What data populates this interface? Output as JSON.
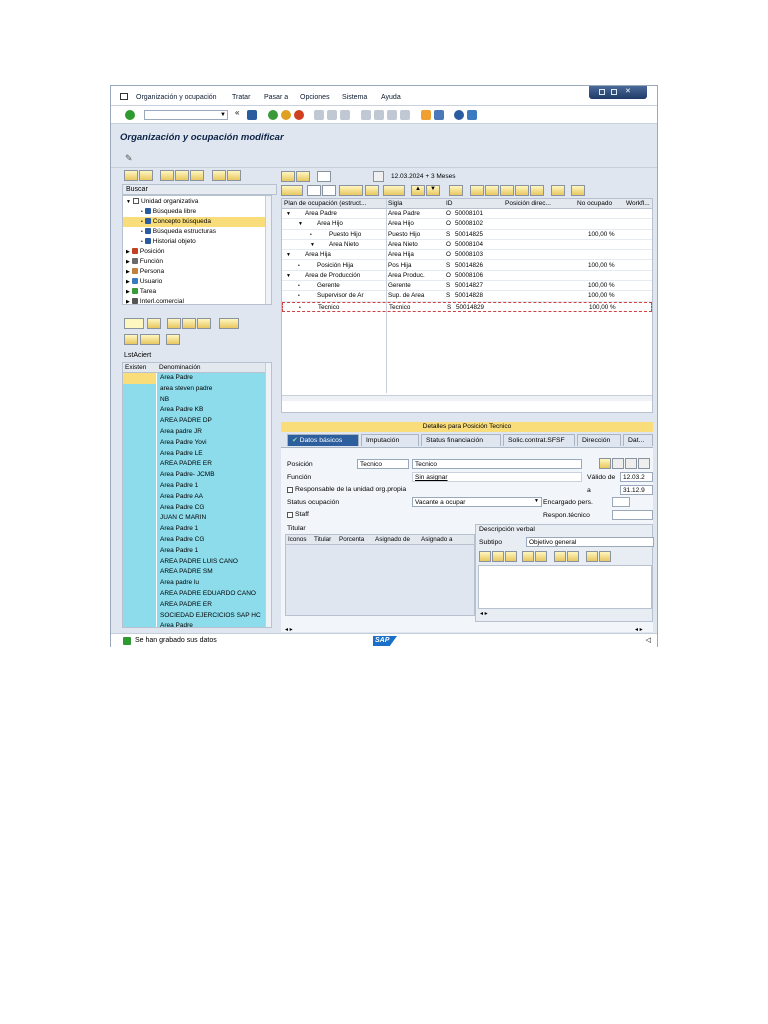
{
  "menu": {
    "items": [
      "Organización y ocupación",
      "Tratar",
      "Pasar a",
      "Opciones",
      "Sistema",
      "Ayuda"
    ]
  },
  "title": "Organización y ocupación modificar",
  "search": {
    "label": "Buscar"
  },
  "tree": [
    {
      "text": "Unidad organizativa",
      "level": 0,
      "icon": "square-icon",
      "expanded": true
    },
    {
      "text": "Búsqueda libre",
      "level": 1,
      "icon": "binoculars-icon"
    },
    {
      "text": "Concepto búsqueda",
      "level": 1,
      "icon": "binoculars-icon",
      "selected": true
    },
    {
      "text": "Búsqueda estructuras",
      "level": 1,
      "icon": "binoculars-icon"
    },
    {
      "text": "Historial objeto",
      "level": 1,
      "icon": "binoculars-icon"
    },
    {
      "text": "Posición",
      "level": 0,
      "icon": "person-icon"
    },
    {
      "text": "Función",
      "level": 0,
      "icon": "function-icon"
    },
    {
      "text": "Persona",
      "level": 0,
      "icon": "people-icon"
    },
    {
      "text": "Usuario",
      "level": 0,
      "icon": "user-icon"
    },
    {
      "text": "Tarea",
      "level": 0,
      "icon": "task-icon"
    },
    {
      "text": "Interl.comercial",
      "level": 0,
      "icon": "partner-icon"
    }
  ],
  "lst": {
    "label": "LstAciert",
    "headers": [
      "Existen",
      "Denominación"
    ],
    "rows": [
      "Area Padre",
      "area steven padre",
      "NB",
      "Area Padre KB",
      "AREA PADRE DP",
      "Area padre JR",
      "Area Padre Yovi",
      "Area Padre LE",
      "AREA PADRE ER",
      "Area Padre- JCMB",
      "Area Padre 1",
      "Area Padre AA",
      "Area Padre CG",
      "JUAN C MARIN",
      "Area Padre 1",
      "Area Padre CG",
      "Area Padre 1",
      "AREA PADRE LUIS CANO",
      "AREA PADRE SM",
      "Area padre lu",
      "AREA PADRE EDUARDO CANO",
      "AREA PADRE ER",
      "SOCIEDAD EJERCICIOS SAP HC",
      "Area Padre"
    ]
  },
  "date_range": "12.03.2024  + 3 Meses",
  "grid": {
    "headers": [
      "Plan de ocupación (estruct...",
      "Sigla",
      "ID",
      "Posición direc...",
      "No ocupado",
      "Workfl..."
    ],
    "rows": [
      {
        "name": "Area Padre",
        "level": 0,
        "icon": "square-icon",
        "sigla": "Area Padre",
        "type": "O",
        "id": "50008101",
        "pct": ""
      },
      {
        "name": "Area Hijo",
        "level": 1,
        "icon": "square-icon",
        "sigla": "Area Hijo",
        "type": "O",
        "id": "50008102",
        "pct": ""
      },
      {
        "name": "Puesto Hijo",
        "level": 2,
        "icon": "person-icon",
        "sigla": "Puesto Hijo",
        "type": "S",
        "id": "50014825",
        "pct": "100,00 %"
      },
      {
        "name": "Area Nieto",
        "level": 2,
        "icon": "square-icon",
        "sigla": "Area Nieto",
        "type": "O",
        "id": "50008104",
        "pct": ""
      },
      {
        "name": "Area Hija",
        "level": 0,
        "icon": "square-icon",
        "sigla": "Area Hija",
        "type": "O",
        "id": "50008103",
        "pct": ""
      },
      {
        "name": "Posición Hija",
        "level": 1,
        "icon": "person-icon",
        "sigla": "Pos Hija",
        "type": "S",
        "id": "50014826",
        "pct": "100,00 %"
      },
      {
        "name": "Area de Producción",
        "level": 0,
        "icon": "square-icon",
        "sigla": "Area Produc.",
        "type": "O",
        "id": "50008106",
        "pct": ""
      },
      {
        "name": "Gerente",
        "level": 1,
        "icon": "person-icon",
        "sigla": "Gerente",
        "type": "S",
        "id": "50014827",
        "pct": "100,00 %"
      },
      {
        "name": "Supervisor de Ar",
        "level": 1,
        "icon": "person-icon",
        "sigla": "Sup. de Area",
        "type": "S",
        "id": "50014828",
        "pct": "100,00 %"
      },
      {
        "name": "Tecnico",
        "level": 1,
        "icon": "person-icon",
        "sigla": "Tecnico",
        "type": "S",
        "id": "50014829",
        "pct": "100,00 %",
        "selected": true
      }
    ]
  },
  "details": {
    "header": "Detalles para Posición Tecnico",
    "tabs": [
      "Datos básicos",
      "Imputación",
      "Status financiación",
      "Solic.contrat.SFSF",
      "Dirección",
      "Dat..."
    ],
    "posicion_label": "Posición",
    "posicion_short": "Tecnico",
    "posicion_long": "Tecnico",
    "funcion_label": "Función",
    "funcion_value": "Sin asignar",
    "valido_label": "Válido de",
    "valido_from": "12.03.2",
    "a_label": "a",
    "valido_to": "31.12.9",
    "responsable_label": "Responsable de la unidad org.propia",
    "status_label": "Status ocupación",
    "status_value": "Vacante a ocupar",
    "encargado_label": "Encargado pers.",
    "staff_label": "Staff",
    "respon_label": "Respon.técnico",
    "titular_label": "Titular",
    "titular_headers": [
      "Iconos",
      "Titular",
      "Porcenta",
      "Asignado de",
      "Asignado a"
    ],
    "desc_label": "Descripción verbal",
    "subtipo_label": "Subtipo",
    "subtipo_value": "Objetivo general"
  },
  "status": {
    "message": "Se han grabado sus datos"
  },
  "brand": {
    "logo": "SAP"
  },
  "colors": {
    "selection": "#f8dd7a",
    "list": "#8ddcec",
    "tab_active": "#2d5f9e"
  }
}
